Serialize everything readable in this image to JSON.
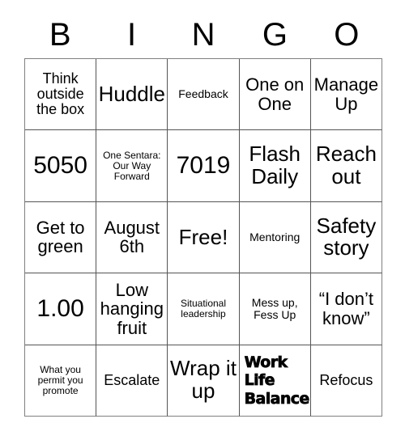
{
  "card": {
    "title": "BINGO",
    "header_letters": [
      "B",
      "I",
      "N",
      "G",
      "O"
    ],
    "columns": 5,
    "rows": 5,
    "colors": {
      "background": "#ffffff",
      "text": "#000000",
      "grid_line": "#555555",
      "outer_line": "#808080"
    },
    "cells": [
      {
        "text": "Think outside the box",
        "size": "s-md",
        "bold": false
      },
      {
        "text": "Huddle",
        "size": "s-xl",
        "bold": false
      },
      {
        "text": "Feedback",
        "size": "s-sm",
        "bold": false
      },
      {
        "text": "One on One",
        "size": "s-lg",
        "bold": false
      },
      {
        "text": "Manage Up",
        "size": "s-lg",
        "bold": false
      },
      {
        "text": "5050",
        "size": "s-xxl",
        "bold": false
      },
      {
        "text": "One Sentara: Our Way Forward",
        "size": "s-xs",
        "bold": false
      },
      {
        "text": "7019",
        "size": "s-xxl",
        "bold": false
      },
      {
        "text": "Flash Daily",
        "size": "s-xl",
        "bold": false
      },
      {
        "text": "Reach out",
        "size": "s-xl",
        "bold": false
      },
      {
        "text": "Get to green",
        "size": "s-lg",
        "bold": false
      },
      {
        "text": "August 6th",
        "size": "s-lg",
        "bold": false
      },
      {
        "text": "Free!",
        "size": "s-xl",
        "bold": false
      },
      {
        "text": "Mentoring",
        "size": "s-sm",
        "bold": false
      },
      {
        "text": "Safety story",
        "size": "s-xl",
        "bold": false
      },
      {
        "text": "1.00",
        "size": "s-xxl",
        "bold": false
      },
      {
        "text": "Low hanging fruit",
        "size": "s-lg",
        "bold": false
      },
      {
        "text": "Situational leadership",
        "size": "s-xs",
        "bold": false
      },
      {
        "text": "Mess up, Fess Up",
        "size": "s-sm",
        "bold": false
      },
      {
        "text": "“I don’t know”",
        "size": "s-lg",
        "bold": false
      },
      {
        "text": "What you permit you promote",
        "size": "s-xs",
        "bold": false
      },
      {
        "text": "Escalate",
        "size": "s-md",
        "bold": false
      },
      {
        "text": "Wrap it up",
        "size": "s-xl",
        "bold": false
      },
      {
        "text": "Work Life Balance",
        "size": "s-md",
        "bold": true
      },
      {
        "text": "Refocus",
        "size": "s-md",
        "bold": false
      }
    ]
  }
}
